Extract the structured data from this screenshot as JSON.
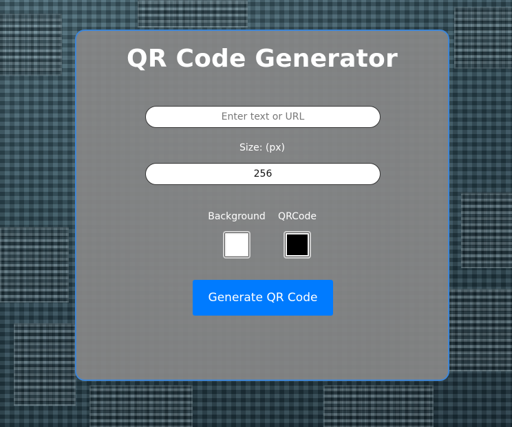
{
  "app": {
    "title": "QR Code Generator"
  },
  "form": {
    "text_input": {
      "placeholder": "Enter text or URL",
      "value": ""
    },
    "size_label": "Size: (px)",
    "size_input": {
      "value": "256"
    },
    "colors": {
      "background": {
        "label": "Background",
        "value": "#ffffff"
      },
      "qrcode": {
        "label": "QRCode",
        "value": "#000000"
      }
    },
    "generate_label": "Generate QR Code"
  },
  "theme": {
    "accent": "#007bff",
    "card_border": "#3f86d6",
    "card_background": "#878787"
  }
}
